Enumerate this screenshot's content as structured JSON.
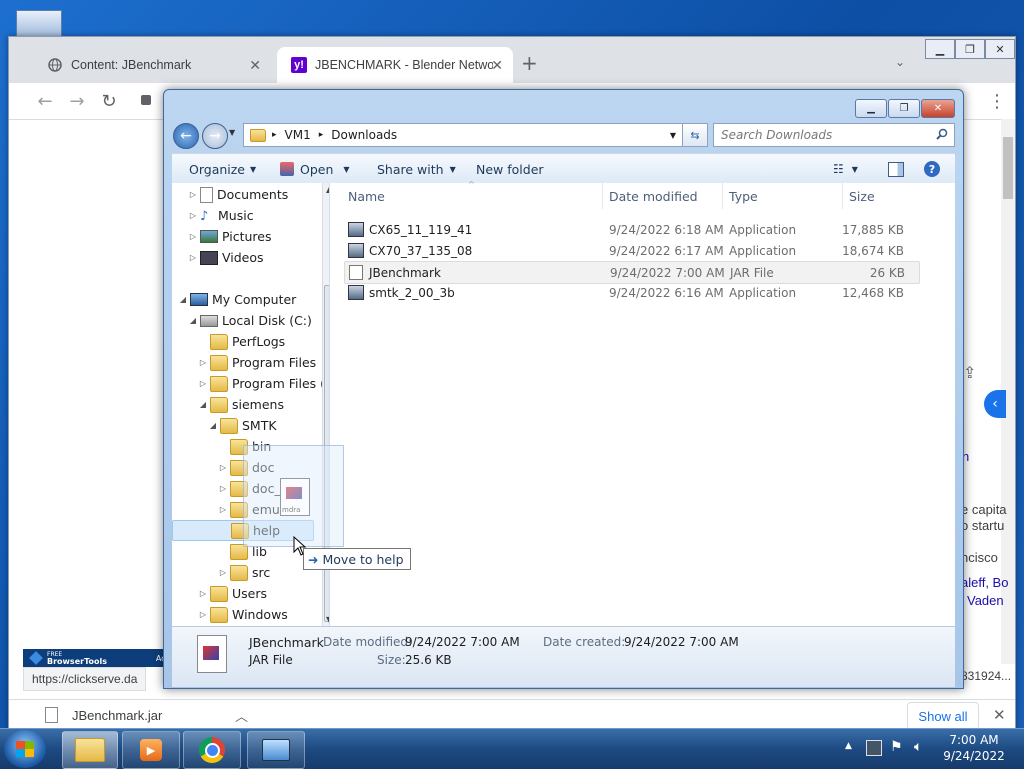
{
  "browser": {
    "tabs": [
      {
        "label": "Content: JBenchmark"
      },
      {
        "label": "JBENCHMARK - Blender Networ"
      }
    ],
    "new_tab": "+",
    "status_url": "https://clickserve.da",
    "right_url_fragment": "831924...",
    "download_file": "JBenchmark.jar",
    "show_all": "Show all",
    "page_snippets": [
      "n",
      "e capita",
      "o startu",
      "ncisco",
      "aleff, Bo",
      "Vaden"
    ],
    "browsertools_label": "BrowserTools",
    "browsertools_small": "FREE",
    "adv_label": "Adv"
  },
  "explorer": {
    "breadcrumb": [
      "VM1",
      "Downloads"
    ],
    "search_placeholder": "Search Downloads",
    "commands": {
      "organize": "Organize",
      "open": "Open",
      "share_with": "Share with",
      "new_folder": "New folder"
    },
    "nav_tree": [
      {
        "label": "Documents",
        "icon": "documents-icon"
      },
      {
        "label": "Music",
        "icon": "music-icon"
      },
      {
        "label": "Pictures",
        "icon": "pictures-icon"
      },
      {
        "label": "Videos",
        "icon": "videos-icon"
      },
      {
        "label": "My Computer",
        "icon": "computer-icon"
      },
      {
        "label": "Local Disk (C:)",
        "icon": "disk-icon"
      },
      {
        "label": "PerfLogs",
        "icon": "folder-icon"
      },
      {
        "label": "Program Files",
        "icon": "folder-icon"
      },
      {
        "label": "Program Files (",
        "icon": "folder-icon"
      },
      {
        "label": "siemens",
        "icon": "folder-icon"
      },
      {
        "label": "SMTK",
        "icon": "folder-icon"
      },
      {
        "label": "bin",
        "icon": "folder-icon"
      },
      {
        "label": "doc",
        "icon": "folder-icon"
      },
      {
        "label": "doc_",
        "icon": "folder-icon"
      },
      {
        "label": "emu",
        "icon": "folder-icon"
      },
      {
        "label": "help",
        "icon": "folder-icon"
      },
      {
        "label": "lib",
        "icon": "folder-icon"
      },
      {
        "label": "src",
        "icon": "folder-icon"
      },
      {
        "label": "Users",
        "icon": "folder-icon"
      },
      {
        "label": "Windows",
        "icon": "folder-icon"
      }
    ],
    "columns": [
      "Name",
      "Date modified",
      "Type",
      "Size"
    ],
    "files": [
      {
        "name": "CX65_11_119_41",
        "date": "9/24/2022 6:18 AM",
        "type": "Application",
        "size": "17,885 KB"
      },
      {
        "name": "CX70_37_135_08",
        "date": "9/24/2022 6:17 AM",
        "type": "Application",
        "size": "18,674 KB"
      },
      {
        "name": "JBenchmark",
        "date": "9/24/2022 7:00 AM",
        "type": "JAR File",
        "size": "26 KB"
      },
      {
        "name": "smtk_2_00_3b",
        "date": "9/24/2022 6:16 AM",
        "type": "Application",
        "size": "12,468 KB"
      }
    ],
    "drag_tooltip": "Move to help",
    "drag_ghost_text": "mdra",
    "details": {
      "name": "JBenchmark",
      "type": "JAR File",
      "date_modified_label": "Date modified:",
      "date_modified": "9/24/2022 7:00 AM",
      "date_created_label": "Date created:",
      "date_created": "9/24/2022 7:00 AM",
      "size_label": "Size:",
      "size": "25.6 KB"
    }
  },
  "taskbar": {
    "time": "7:00 AM",
    "date": "9/24/2022"
  },
  "colors": {
    "desktop": "#1c63b8",
    "selection": "#cce8ff",
    "chrome_tabstrip": "#dee1e6",
    "accent_blue": "#1a73e8"
  }
}
